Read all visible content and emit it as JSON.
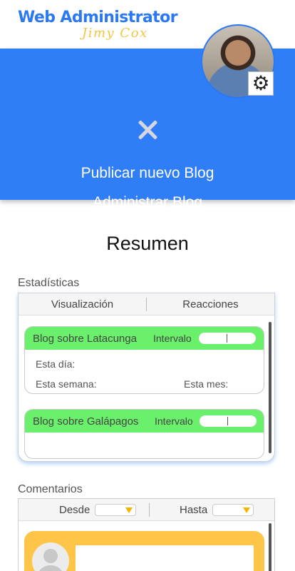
{
  "header": {
    "brand_title": "Web Administrator",
    "brand_subtitle": "Jimy Cox"
  },
  "menu": {
    "items": [
      {
        "label": "Publicar nuevo Blog"
      },
      {
        "label": "Administrar Blog"
      }
    ]
  },
  "icons": {
    "close": "close-icon",
    "settings": "gear-icon",
    "avatar": "user-avatar",
    "dropdown": "chevron-down-icon"
  },
  "colors": {
    "brand_blue": "#2f7ef6",
    "accent_yellow": "#f5c542",
    "card_green": "#6af06a",
    "comment_card": "#ffc548"
  },
  "summary": {
    "title": "Resumen"
  },
  "stats": {
    "section_label": "Estadísticas",
    "tabs": [
      {
        "label": "Visualización"
      },
      {
        "label": "Reacciones"
      }
    ],
    "cards": [
      {
        "title": "Blog sobre Latacunga",
        "interval_label": "Intervalo",
        "rows": {
          "day": "Esta día:",
          "week": "Esta semana:",
          "month": "Esta mes:"
        }
      },
      {
        "title": "Blog sobre Galápagos",
        "interval_label": "Intervalo"
      }
    ]
  },
  "comments": {
    "section_label": "Comentarios",
    "filters": {
      "from_label": "Desde",
      "to_label": "Hasta"
    }
  }
}
